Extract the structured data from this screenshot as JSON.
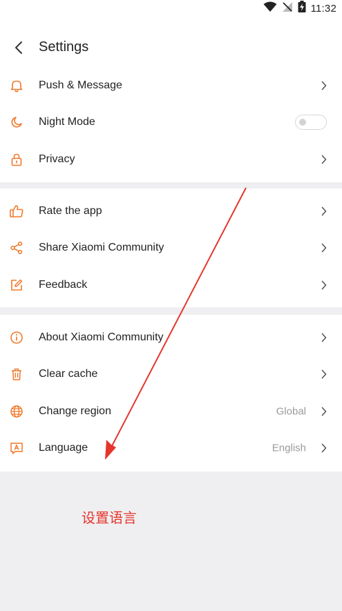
{
  "status_bar": {
    "time": "11:32"
  },
  "header": {
    "title": "Settings"
  },
  "groups": [
    {
      "items": [
        {
          "label": "Push & Message"
        },
        {
          "label": "Night Mode",
          "toggle": false
        },
        {
          "label": "Privacy"
        }
      ]
    },
    {
      "items": [
        {
          "label": "Rate the app"
        },
        {
          "label": "Share Xiaomi Community"
        },
        {
          "label": "Feedback"
        }
      ]
    },
    {
      "items": [
        {
          "label": "About Xiaomi Community"
        },
        {
          "label": "Clear cache"
        },
        {
          "label": "Change region",
          "value": "Global"
        },
        {
          "label": "Language",
          "value": "English"
        }
      ]
    }
  ],
  "annotation": {
    "text": "设置语言"
  },
  "colors": {
    "accent": "#f0782a",
    "annotation_red": "#e5352c",
    "background": "#efeff1"
  }
}
